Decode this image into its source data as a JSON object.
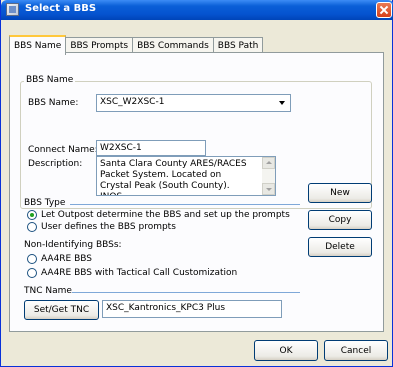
{
  "window": {
    "title": "Select a BBS"
  },
  "tabs": [
    {
      "label": "BBS Name"
    },
    {
      "label": "BBS Prompts"
    },
    {
      "label": "BBS Commands"
    },
    {
      "label": "BBS Path"
    }
  ],
  "bbs_name_group": {
    "legend": "BBS Name",
    "bbs_name_label": "BBS Name:",
    "bbs_name_value": "XSC_W2XSC-1",
    "connect_name_label": "Connect Name:",
    "connect_name_value": "W2XSC-1",
    "description_label": "Description:",
    "description_value": "Santa Clara County ARES/RACES Packet System.  Located on Crystal Peak (South County).  JNOS."
  },
  "bbs_type": {
    "title": "BBS Type",
    "options": [
      {
        "label": "Let Outpost determine the BBS and set up the prompts",
        "checked": true
      },
      {
        "label": "User defines the BBS prompts",
        "checked": false
      }
    ]
  },
  "non_identifying": {
    "title": "Non-Identifying BBSs:",
    "options": [
      {
        "label": "AA4RE BBS",
        "checked": false
      },
      {
        "label": "AA4RE BBS with Tactical Call Customization",
        "checked": false
      }
    ]
  },
  "tnc": {
    "title": "TNC Name",
    "button_label": "Set/Get TNC",
    "value": "XSC_Kantronics_KPC3 Plus"
  },
  "side_buttons": {
    "new_label": "New",
    "copy_label": "Copy",
    "delete_label": "Delete"
  },
  "footer": {
    "ok_label": "OK",
    "cancel_label": "Cancel"
  },
  "colors": {
    "titlebar": "#0553d0",
    "dialog_bg": "#ece9d8",
    "panel_bg": "#fcfcfe",
    "active_tab_accent": "#ffc83c",
    "radio_dot": "#21a121",
    "section_line": "#7fa8d8"
  }
}
